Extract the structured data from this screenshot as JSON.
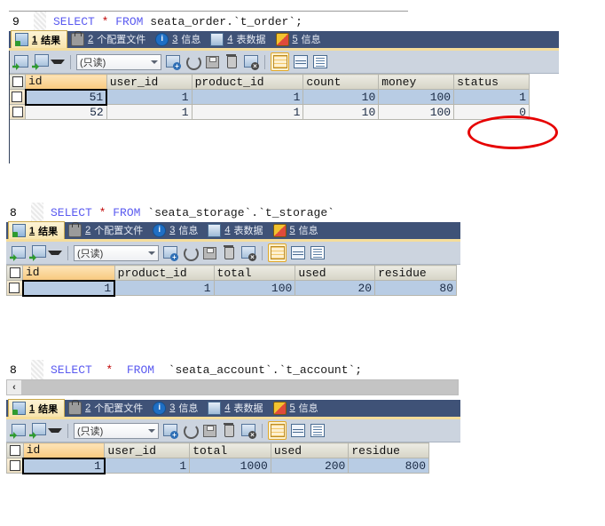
{
  "common": {
    "tabs": [
      {
        "num": "1",
        "label": "结果",
        "icon": "result-grid-icon",
        "active": true
      },
      {
        "num": "2",
        "label": "个配置文件",
        "icon": "profile-lock-icon",
        "active": false
      },
      {
        "num": "3",
        "label": "信息",
        "icon": "info-circle-icon",
        "active": false
      },
      {
        "num": "4",
        "label": "表数据",
        "icon": "table-data-icon",
        "active": false
      },
      {
        "num": "5",
        "label": "信息",
        "icon": "message-icon",
        "active": false
      }
    ],
    "toolbar": {
      "readonly_label": "(只读)",
      "buttons": [
        {
          "name": "apply-changes-button",
          "icon": "grid-green-arrow-icon"
        },
        {
          "name": "export-wizard-button",
          "icon": "grid-export-icon"
        },
        {
          "name": "toolbar-dropdown-button",
          "icon": "caret-down-icon"
        },
        {
          "name": "insert-record-button",
          "icon": "record-add-icon"
        },
        {
          "name": "refresh-button",
          "icon": "refresh-icon"
        },
        {
          "name": "save-record-button",
          "icon": "floppy-save-icon"
        },
        {
          "name": "delete-record-button",
          "icon": "trash-icon"
        },
        {
          "name": "cancel-edit-button",
          "icon": "record-cancel-icon"
        },
        {
          "name": "grid-view-button",
          "icon": "grid-view-icon"
        },
        {
          "name": "form-view-button",
          "icon": "form-view-icon"
        },
        {
          "name": "text-view-button",
          "icon": "text-view-icon"
        }
      ]
    }
  },
  "sections": [
    {
      "id": "order",
      "sql": {
        "line_number": "9",
        "keyword1": "SELECT",
        "star": "*",
        "keyword2": "FROM",
        "target": "seata_order.`t_order`;"
      },
      "grid": {
        "columns": [
          "id",
          "user_id",
          "product_id",
          "count",
          "money",
          "status"
        ],
        "sorted_column": "id",
        "rows": [
          {
            "selected": true,
            "cells": [
              "51",
              "1",
              "1",
              "10",
              "100",
              "1"
            ]
          },
          {
            "selected": false,
            "cells": [
              "52",
              "1",
              "1",
              "10",
              "100",
              "0"
            ]
          }
        ]
      },
      "annotation": {
        "type": "red-ellipse",
        "target_cell": "status",
        "target_row": 2
      }
    },
    {
      "id": "storage",
      "sql": {
        "line_number": "8",
        "keyword1": "SELECT",
        "star": "*",
        "keyword2": "FROM",
        "target": "`seata_storage`.`t_storage`"
      },
      "grid": {
        "columns": [
          "id",
          "product_id",
          "total",
          "used",
          "residue"
        ],
        "sorted_column": "id",
        "rows": [
          {
            "selected": true,
            "cells": [
              "1",
              "1",
              "100",
              "20",
              "80"
            ]
          }
        ]
      }
    },
    {
      "id": "account",
      "sql": {
        "line_number": "8",
        "keyword1": "SELECT",
        "star": "*",
        "keyword2": "FROM",
        "target": "`seata_account`.`t_account`;"
      },
      "scrollbar": {
        "left_arrow": "‹"
      },
      "grid": {
        "columns": [
          "id",
          "user_id",
          "total",
          "used",
          "residue"
        ],
        "sorted_column": "id",
        "rows": [
          {
            "selected": true,
            "cells": [
              "1",
              "1",
              "1000",
              "200",
              "800"
            ]
          }
        ]
      }
    }
  ],
  "colors": {
    "tabbar_bg": "#3f5277",
    "tab_active_bg": "#f7e4ae",
    "toolbar_bg": "#ccd4df",
    "row_selected": "#b8cce4",
    "sorted_header": "#f8c97e",
    "annotation_red": "#e60000",
    "sql_keyword": "#5a5af0"
  }
}
